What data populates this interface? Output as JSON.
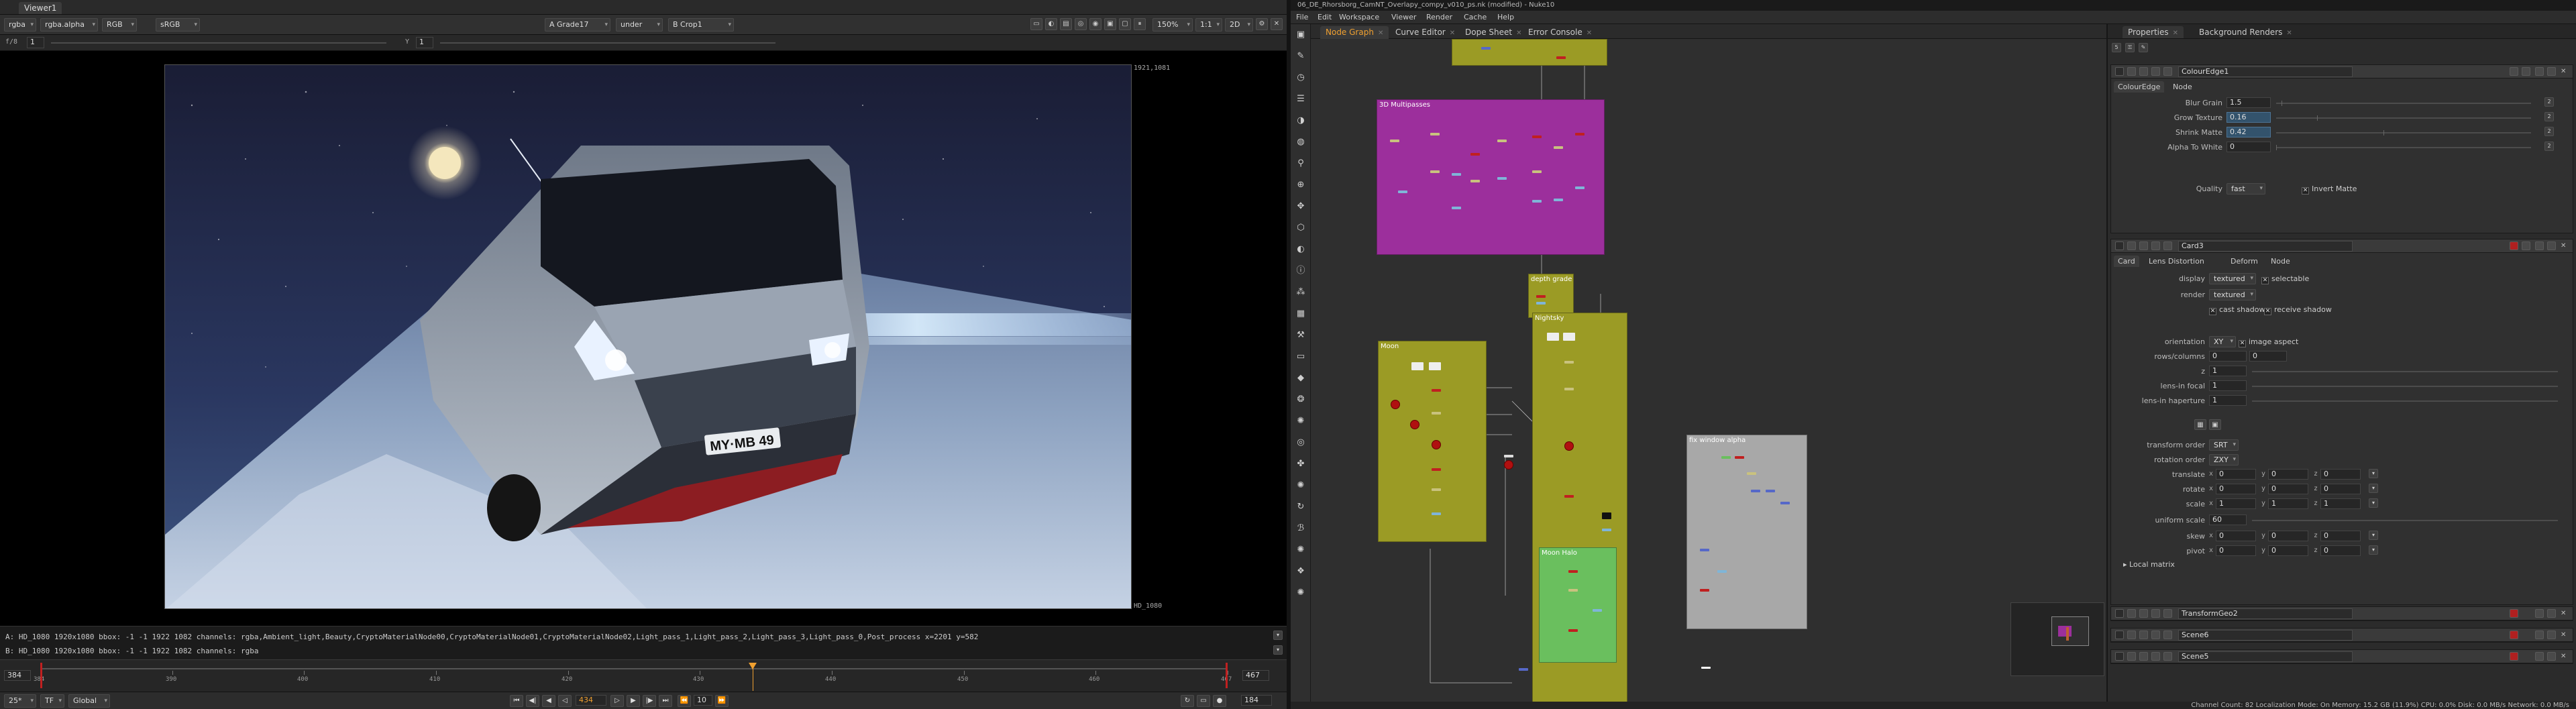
{
  "viewer": {
    "tab": "Viewer1",
    "channels": "rgba",
    "layer": "rgba.alpha",
    "display": "RGB",
    "colorspace": "sRGB",
    "input_a": "A  Grade17",
    "wipe_mode": "under",
    "input_b": "B  Crop1",
    "zoom": "150%",
    "ratio": "1:1",
    "view_mode": "2D",
    "gain_label": "f/8",
    "gain_value": "1",
    "gamma_label": "Y",
    "gamma_value": "1",
    "format_top_right": "1921,1081",
    "format_bottom_right": "HD_1080",
    "plate_text": "MY·MB 49",
    "info_a": "A:  HD_1080 1920x1080  bbox: -1 -1 1922 1082 channels: rgba,Ambient_light,Beauty,CryptoMaterialNode00,CryptoMaterialNode01,CryptoMaterialNode02,Light_pass_1,Light_pass_2,Light_pass_3,Light_pass_0,Post_process  x=2201 y=582",
    "info_b": "B:  HD_1080 1920x1080  bbox: -1 -1 1922 1082 channels: rgba",
    "info_b_coords": "x=2201 y=582",
    "timeline": {
      "start": "384",
      "end": "467",
      "current": "434",
      "ticks": [
        "384",
        "390",
        "400",
        "410",
        "420",
        "430",
        "440",
        "450",
        "460",
        "467"
      ],
      "current_fraction": 0.6
    },
    "playbar": {
      "fps": "25*",
      "tf": "TF",
      "global": "Global",
      "frame": "434",
      "step": "10",
      "end_frame": "184"
    }
  },
  "app": {
    "title": "06_DE_Rhorsborg_CamNT_Overlapy_compy_v010_ps.nk (modified) - Nuke10",
    "menus": [
      "File",
      "Edit",
      "Workspace",
      "Viewer",
      "Render",
      "Cache",
      "Help"
    ],
    "graph_tabs": [
      "Node Graph",
      "Curve Editor",
      "Dope Sheet",
      "Error Console"
    ],
    "backdrops": {
      "multipasses": "3D Multipasses",
      "depth": "depth grade",
      "moon": "Moon",
      "nightsky": "Nightsky",
      "moonhalo": "Moon Halo",
      "window": "fix window alpha"
    },
    "status": "Channel Count: 82  Localization Mode: On  Memory: 15.2 GB (11.9%)  CPU: 0.0%  Disk: 0.0 MB/s  Network: 0.0 MB/s"
  },
  "properties": {
    "tabs": [
      "Properties",
      "Background Renders"
    ],
    "colouredge": {
      "name": "ColourEdge1",
      "tabs": [
        "ColourEdge",
        "Node"
      ],
      "knobs": [
        {
          "label": "Blur Grain",
          "value": "1.5",
          "slider": 0.02
        },
        {
          "label": "Grow Texture",
          "value": "0.16",
          "slider": 0.16
        },
        {
          "label": "Shrink Matte",
          "value": "0.42",
          "slider": 0.42
        },
        {
          "label": "Alpha To White",
          "value": "0",
          "slider": 0
        }
      ],
      "quality_label": "Quality",
      "quality_value": "fast",
      "invert_label": "Invert Matte"
    },
    "card": {
      "name": "Card3",
      "tabs": [
        "Card",
        "Lens Distortion",
        "Deform",
        "Node"
      ],
      "display_label": "display",
      "display_value": "textured",
      "selectable": "selectable",
      "render_label": "render",
      "render_value": "textured",
      "cast_shadow": "cast shadow",
      "receive_shadow": "receive shadow",
      "orientation_label": "orientation",
      "orientation_value": "XY",
      "image_aspect": "image aspect",
      "rows_label": "rows/columns",
      "rows_value": "0",
      "cols_value": "0",
      "z_label": "z",
      "z_value": "1",
      "lens_focal_label": "lens-in focal",
      "lens_focal_value": "1",
      "lens_haperture_label": "lens-in haperture",
      "lens_haperture_value": "1",
      "transform_order_label": "transform order",
      "transform_order_value": "SRT",
      "rotation_order_label": "rotation order",
      "rotation_order_value": "ZXY",
      "xyz": [
        {
          "label": "translate",
          "x": "0",
          "y": "0",
          "z": "0"
        },
        {
          "label": "rotate",
          "x": "0",
          "y": "0",
          "z": "0"
        },
        {
          "label": "scale",
          "x": "1",
          "y": "1",
          "z": "1"
        }
      ],
      "uniform_scale_label": "uniform scale",
      "uniform_scale_value": "60",
      "xy": [
        {
          "label": "skew",
          "x": "0",
          "y": "0",
          "z": "0"
        },
        {
          "label": "pivot",
          "x": "0",
          "y": "0",
          "z": "0"
        }
      ],
      "local_matrix": "Local matrix"
    },
    "collapsed": [
      "TransformGeo2",
      "Scene6",
      "Scene5"
    ]
  },
  "colors": {
    "accent": "#f0a030",
    "backdrop_magenta": "#9c2f9c",
    "backdrop_olive": "#9b9b25",
    "backdrop_green": "#6abf5e",
    "backdrop_grey": "#a8a8a8"
  }
}
